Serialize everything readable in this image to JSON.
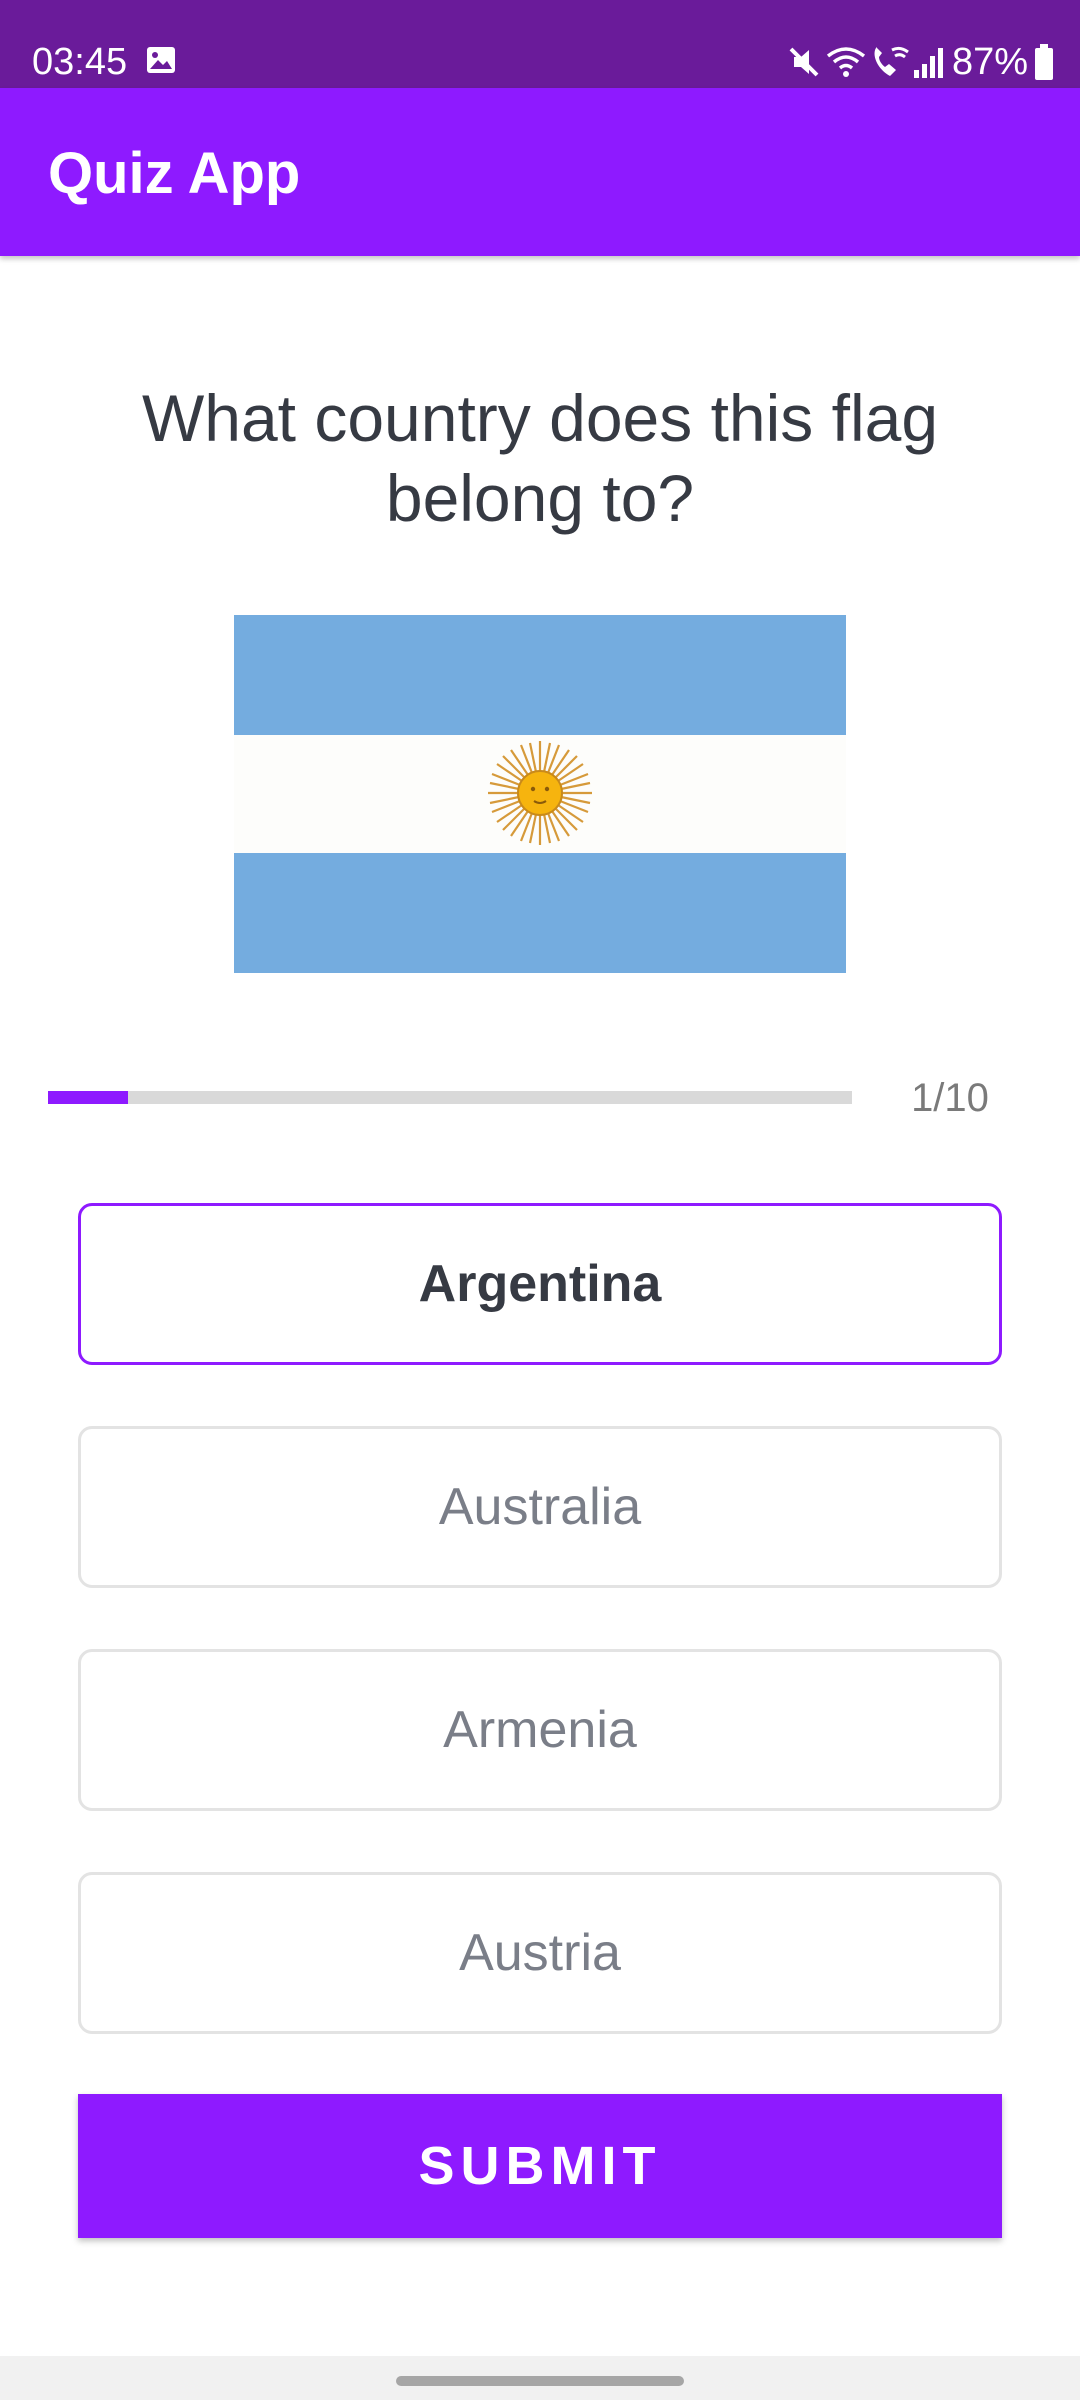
{
  "status_bar": {
    "time": "03:45",
    "battery": "87%",
    "icons": [
      "gallery-icon",
      "mute-icon",
      "wifi-icon",
      "wifi-call-icon",
      "signal-icon",
      "battery-icon"
    ]
  },
  "app_bar": {
    "title": "Quiz App"
  },
  "quiz": {
    "question": "What country does this flag belong to?",
    "flag_image": "argentina-flag",
    "progress": {
      "current": 1,
      "total": 10,
      "fraction": 0.1,
      "label": "1/10"
    },
    "options": [
      {
        "label": "Argentina",
        "selected": true
      },
      {
        "label": "Australia",
        "selected": false
      },
      {
        "label": "Armenia",
        "selected": false
      },
      {
        "label": "Austria",
        "selected": false
      }
    ],
    "submit_label": "SUBMIT"
  },
  "colors": {
    "status_bar": "#6a1b9a",
    "accent": "#8e1aff",
    "text_dark": "#363a43",
    "text_muted": "#7a7e88",
    "border": "#e3e3e3",
    "flag_blue": "#74acdf"
  }
}
